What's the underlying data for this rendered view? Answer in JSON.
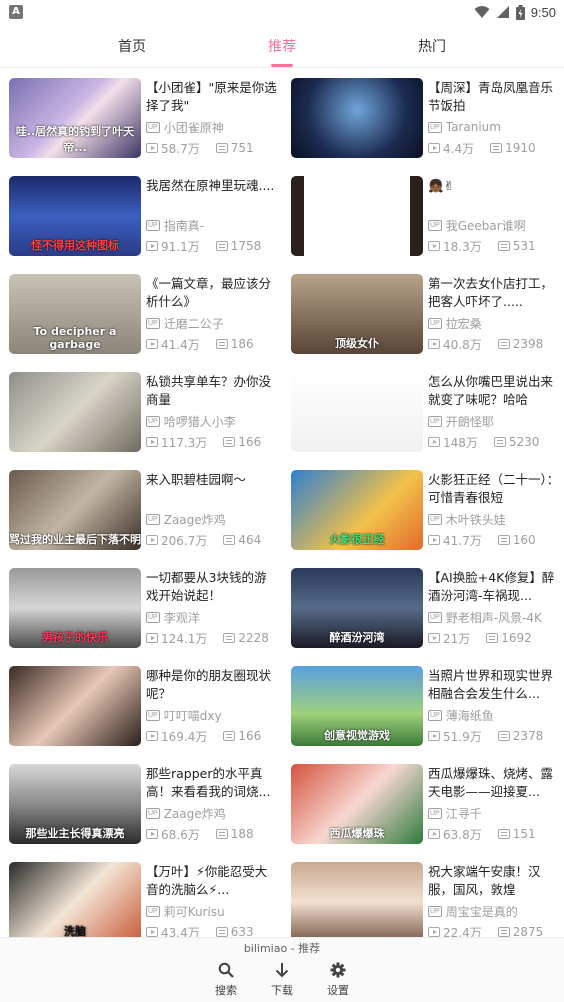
{
  "status_bar": {
    "time": "9:50",
    "app_icon": "A"
  },
  "tabs": [
    {
      "label": "首页"
    },
    {
      "label": "推荐"
    },
    {
      "label": "热门"
    }
  ],
  "videos": [
    {
      "title": "【小团雀】\"原来是你选择了我\"",
      "up": "小团雀原神",
      "views": "58.7万",
      "danmaku": "751",
      "thumb_text": "哇..居然真的钓到了叶天帝..."
    },
    {
      "title": "【周深】青岛凤凰音乐节饭拍",
      "up": "Taranium",
      "views": "4.4万",
      "danmaku": "1910",
      "thumb_text": ""
    },
    {
      "title": "我居然在原神里玩魂....",
      "up": "指南真-",
      "views": "91.1万",
      "danmaku": "1758",
      "thumb_text": "怪不得用这种图标"
    },
    {
      "title": "👧🏾✌",
      "up": "我Geebar谁啊",
      "views": "18.3万",
      "danmaku": "531",
      "thumb_text": ""
    },
    {
      "title": "《一篇文章，最应该分析什么》",
      "up": "迁磨二公子",
      "views": "41.4万",
      "danmaku": "186",
      "thumb_text": "To decipher a garbage"
    },
    {
      "title": "第一次去女仆店打工，把客人吓坏了.....",
      "up": "拉宏桑",
      "views": "40.8万",
      "danmaku": "2398",
      "thumb_text": "顶级女仆"
    },
    {
      "title": "私锁共享单车？办你没商量",
      "up": "哈啰猎人小李",
      "views": "117.3万",
      "danmaku": "166",
      "thumb_text": ""
    },
    {
      "title": "怎么从你嘴巴里说出来就变了味呢？哈哈",
      "up": "开朗怪耶",
      "views": "148万",
      "danmaku": "5230",
      "thumb_text": ""
    },
    {
      "title": "来入职碧桂园啊～",
      "up": "Zaage炸鸡",
      "views": "206.7万",
      "danmaku": "464",
      "thumb_text": "骂过我的业主最后下落不明"
    },
    {
      "title": "火影狂正经（二十一）：可惜青春很短",
      "up": "木叶铁头娃",
      "views": "41.7万",
      "danmaku": "160",
      "thumb_text": "火影很正经"
    },
    {
      "title": "一切都要从3块钱的游戏开始说起！",
      "up": "李观洋",
      "views": "124.1万",
      "danmaku": "2228",
      "thumb_text": "男孩子的快乐"
    },
    {
      "title": "【AI换脸+4K修复】醉酒汾河湾-车祸现...",
      "up": "野老相声-风景-4K",
      "views": "21万",
      "danmaku": "1692",
      "thumb_text": "醉酒汾河湾"
    },
    {
      "title": "哪种是你的朋友圈现状呢？",
      "up": "叮叮喵dxy",
      "views": "169.4万",
      "danmaku": "166",
      "thumb_text": ""
    },
    {
      "title": "当照片世界和现实世界相融合会发生什么...",
      "up": "薄海纸鱼",
      "views": "51.9万",
      "danmaku": "2378",
      "thumb_text": "创意视觉游戏"
    },
    {
      "title": "那些rapper的水平真高！来看看我的词烧...",
      "up": "Zaage炸鸡",
      "views": "68.6万",
      "danmaku": "188",
      "thumb_text": "那些业主长得真漂亮"
    },
    {
      "title": "西瓜爆爆珠、烧烤、露天电影——迎接夏...",
      "up": "江寻千",
      "views": "63.8万",
      "danmaku": "151",
      "thumb_text": "西瓜爆爆珠"
    },
    {
      "title": "【万叶】⚡你能忍受大音的洗脑么⚡...",
      "up": "莉可Kurisu",
      "views": "43.4万",
      "danmaku": "633",
      "thumb_text": "洗脑"
    },
    {
      "title": "祝大家端午安康！汉服，国风，敦煌",
      "up": "周宝宝是真的",
      "views": "22.4万",
      "danmaku": "2875",
      "thumb_text": ""
    }
  ],
  "bottom": {
    "caption": "bilimiao - 推荐",
    "nav": [
      {
        "label": "搜索",
        "icon": "search-icon"
      },
      {
        "label": "下载",
        "icon": "download-icon"
      },
      {
        "label": "设置",
        "icon": "gear-icon"
      }
    ]
  },
  "colors": {
    "accent": "#fb7299",
    "meta_gray": "#9e9e9e"
  }
}
